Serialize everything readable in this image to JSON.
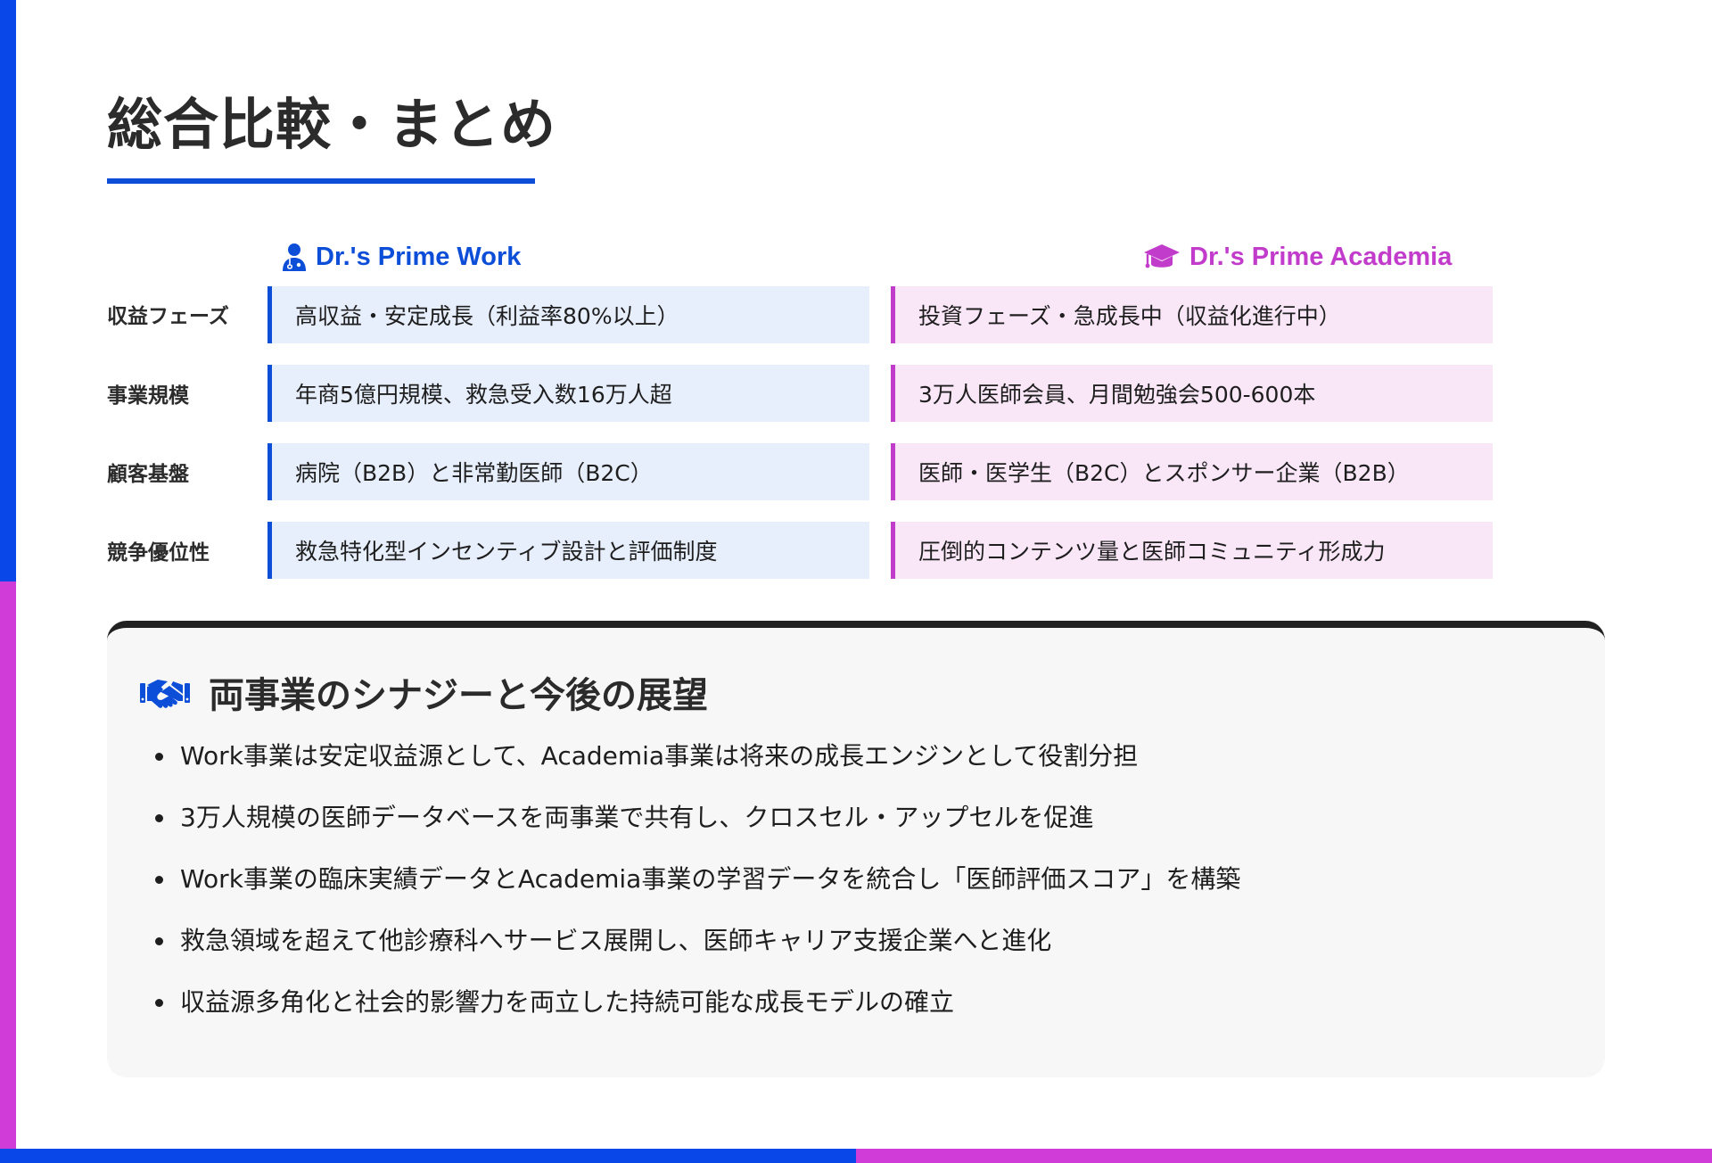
{
  "title": "総合比較・まとめ",
  "columns": {
    "work": {
      "name": "Dr.'s Prime Work",
      "icon": "doctor-icon",
      "color": "#0d4ed8"
    },
    "academia": {
      "name": "Dr.'s Prime Academia",
      "icon": "graduation-cap-icon",
      "color": "#c23ccc"
    }
  },
  "rows": [
    {
      "label": "収益フェーズ",
      "work": "高収益・安定成長（利益率80%以上）",
      "academia": "投資フェーズ・急成長中（収益化進行中）"
    },
    {
      "label": "事業規模",
      "work": "年商5億円規模、救急受入数16万人超",
      "academia": "3万人医師会員、月間勉強会500-600本"
    },
    {
      "label": "顧客基盤",
      "work": "病院（B2B）と非常勤医師（B2C）",
      "academia": "医師・医学生（B2C）とスポンサー企業（B2B）"
    },
    {
      "label": "競争優位性",
      "work": "救急特化型インセンティブ設計と評価制度",
      "academia": "圧倒的コンテンツ量と医師コミュニティ形成力"
    }
  ],
  "synergy": {
    "icon": "handshake-icon",
    "title": "両事業のシナジーと今後の展望",
    "bullets": [
      "Work事業は安定収益源として、Academia事業は将来の成長エンジンとして役割分担",
      "3万人規模の医師データベースを両事業で共有し、クロスセル・アップセルを促進",
      "Work事業の臨床実績データとAcademia事業の学習データを統合し「医師評価スコア」を構築",
      "救急領域を超えて他診療科へサービス展開し、医師キャリア支援企業へと進化",
      "収益源多角化と社会的影響力を両立した持続可能な成長モデルの確立"
    ]
  },
  "colors": {
    "blue": "#0a47e8",
    "magenta": "#d03cd8",
    "dark": "#222222"
  }
}
